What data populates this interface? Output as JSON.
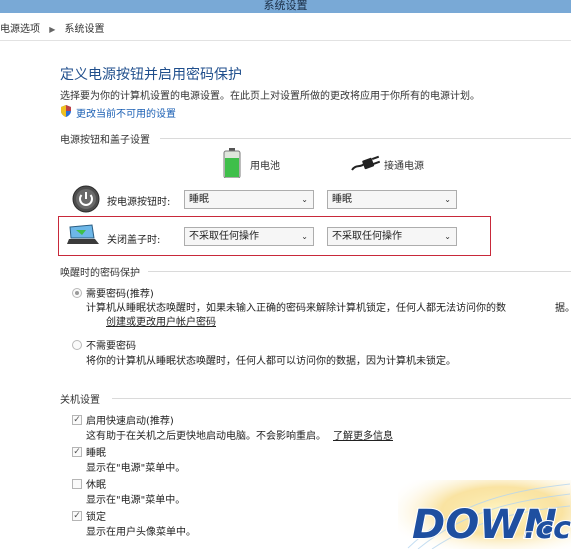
{
  "window": {
    "title": "系统设置"
  },
  "breadcrumb": {
    "items": [
      "电源选项",
      "系统设置"
    ]
  },
  "header": {
    "title": "定义电源按钮并启用密码保护",
    "description": "选择要为你的计算机设置的电源设置。在此页上对设置所做的更改将应用于你所有的电源计划。",
    "change_link": "更改当前不可用的设置"
  },
  "power_section": {
    "title": "电源按钮和盖子设置",
    "columns": [
      "用电池",
      "接通电源"
    ],
    "rows": [
      {
        "label": "按电源按钮时:",
        "battery": "睡眠",
        "plugged": "睡眠"
      },
      {
        "label": "关闭盖子时:",
        "battery": "不采取任何操作",
        "plugged": "不采取任何操作"
      }
    ]
  },
  "password_section": {
    "title": "唤醒时的密码保护",
    "options": [
      {
        "label": "需要密码(推荐)",
        "selected": true,
        "desc": "计算机从睡眠状态唤醒时，如果未输入正确的密码来解除计算机锁定，任何人都无法访问你的数",
        "desc2": "据。",
        "link": "创建或更改用户帐户密码"
      },
      {
        "label": "不需要密码",
        "selected": false,
        "desc": "将你的计算机从睡眠状态唤醒时，任何人都可以访问你的数据，因为计算机未锁定。"
      }
    ]
  },
  "shutdown_section": {
    "title": "关机设置",
    "items": [
      {
        "label": "启用快速启动(推荐)",
        "checked": true,
        "desc": "这有助于在关机之后更快地启动电脑。不会影响重启。",
        "link": "了解更多信息"
      },
      {
        "label": "睡眠",
        "checked": true,
        "desc": "显示在\"电源\"菜单中。"
      },
      {
        "label": "休眠",
        "checked": false,
        "desc": "显示在\"电源\"菜单中。"
      },
      {
        "label": "锁定",
        "checked": true,
        "desc": "显示在用户头像菜单中。"
      }
    ]
  },
  "watermark": {
    "text": "DOWN.cc"
  }
}
